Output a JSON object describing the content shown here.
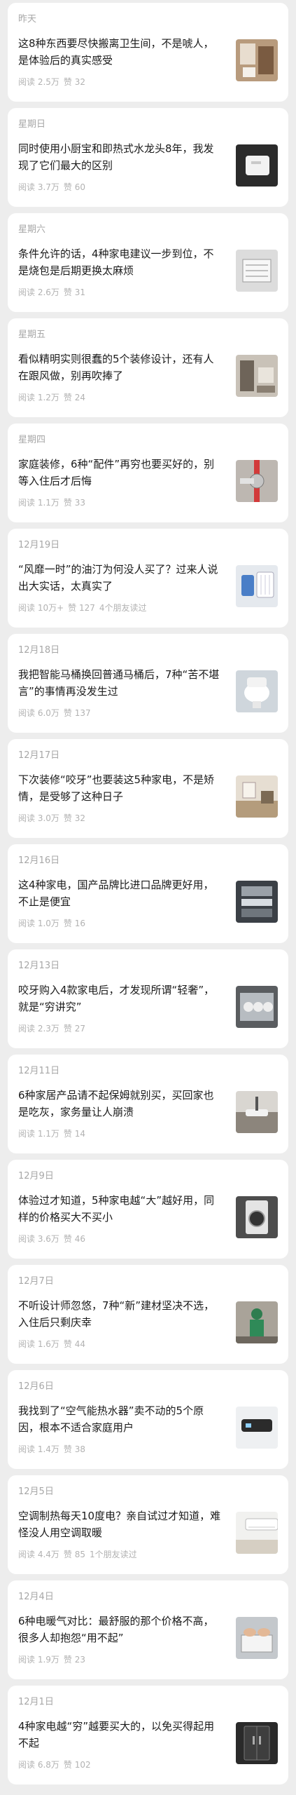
{
  "articles": [
    {
      "date": "昨天",
      "title": "这8种东西要尽快搬离卫生间，不是唬人，是体验后的真实感受",
      "reads": "阅读 2.5万",
      "likes": "赞 32",
      "friends": "",
      "thumb": "bathroom-photo"
    },
    {
      "date": "星期日",
      "title": "同时使用小厨宝和即热式水龙头8年，我发现了它们最大的区别",
      "reads": "阅读 3.7万",
      "likes": "赞 60",
      "friends": "",
      "thumb": "faucet-photo"
    },
    {
      "date": "星期六",
      "title": "条件允许的话，4种家电建议一步到位，不是烧包是后期更换太麻烦",
      "reads": "阅读 2.6万",
      "likes": "赞 31",
      "friends": "",
      "thumb": "ceiling-vent-photo"
    },
    {
      "date": "星期五",
      "title": "看似精明实则很蠢的5个装修设计，还有人在跟风做，别再吹捧了",
      "reads": "阅读 1.2万",
      "likes": "赞 24",
      "friends": "",
      "thumb": "interior-photo"
    },
    {
      "date": "星期四",
      "title": "家庭装修，6种“配件”再穷也要买好的，别等入住后才后悔",
      "reads": "阅读 1.1万",
      "likes": "赞 33",
      "friends": "",
      "thumb": "pipe-valve-photo"
    },
    {
      "date": "12月19日",
      "title": "“风靡一时”的油汀为何没人买了？过来人说出大实话，太真实了",
      "reads": "阅读 10万+",
      "likes": "赞 127",
      "friends": "4个朋友读过",
      "thumb": "heater-photo"
    },
    {
      "date": "12月18日",
      "title": "我把智能马桶换回普通马桶后，7种“苦不堪言”的事情再没发生过",
      "reads": "阅读 6.0万",
      "likes": "赞 137",
      "friends": "",
      "thumb": "toilet-photo"
    },
    {
      "date": "12月17日",
      "title": "下次装修“咬牙”也要装这5种家电，不是矫情，是受够了这种日子",
      "reads": "阅读 3.0万",
      "likes": "赞 32",
      "friends": "",
      "thumb": "living-room-photo"
    },
    {
      "date": "12月16日",
      "title": "这4种家电，国产品牌比进口品牌更好用，不止是便宜",
      "reads": "阅读 1.0万",
      "likes": "赞 16",
      "friends": "",
      "thumb": "appliance-photo"
    },
    {
      "date": "12月13日",
      "title": "咬牙购入4款家电后，才发现所谓“轻奢”，就是“穷讲究”",
      "reads": "阅读 2.3万",
      "likes": "赞 27",
      "friends": "",
      "thumb": "dishwasher-photo"
    },
    {
      "date": "12月11日",
      "title": "6种家居产品请不起保姆就别买，买回家也是吃灰，家务量让人崩溃",
      "reads": "阅读 1.1万",
      "likes": "赞 14",
      "friends": "",
      "thumb": "sink-photo"
    },
    {
      "date": "12月9日",
      "title": "体验过才知道，5种家电越“大”越好用，同样的价格买大不买小",
      "reads": "阅读 3.6万",
      "likes": "赞 46",
      "friends": "",
      "thumb": "washer-photo"
    },
    {
      "date": "12月7日",
      "title": "不听设计师忽悠，7种“新”建材坚决不选，入住后只剩庆幸",
      "reads": "阅读 1.6万",
      "likes": "赞 44",
      "friends": "",
      "thumb": "worker-photo"
    },
    {
      "date": "12月6日",
      "title": "我找到了“空气能热水器”卖不动的5个原因，根本不适合家庭用户",
      "reads": "阅读 1.4万",
      "likes": "赞 38",
      "friends": "",
      "thumb": "water-heater-photo"
    },
    {
      "date": "12月5日",
      "title": "空调制热每天10度电？亲自试过才知道，难怪没人用空调取暖",
      "reads": "阅读 4.4万",
      "likes": "赞 85",
      "friends": "1个朋友读过",
      "thumb": "air-conditioner-photo"
    },
    {
      "date": "12月4日",
      "title": "6种电暖气对比：最舒服的那个价格不高，很多人却抱怨“用不起”",
      "reads": "阅读 1.9万",
      "likes": "赞 23",
      "friends": "",
      "thumb": "hands-heater-photo"
    },
    {
      "date": "12月1日",
      "title": "4种家电越“穷”越要买大的，以免买得起用不起",
      "reads": "阅读 6.8万",
      "likes": "赞 102",
      "friends": "",
      "thumb": "fridge-photo"
    }
  ],
  "colors": {
    "background": "#ededed",
    "card": "#ffffff",
    "text": "#1a1a1a",
    "muted": "#a7a7a7"
  }
}
